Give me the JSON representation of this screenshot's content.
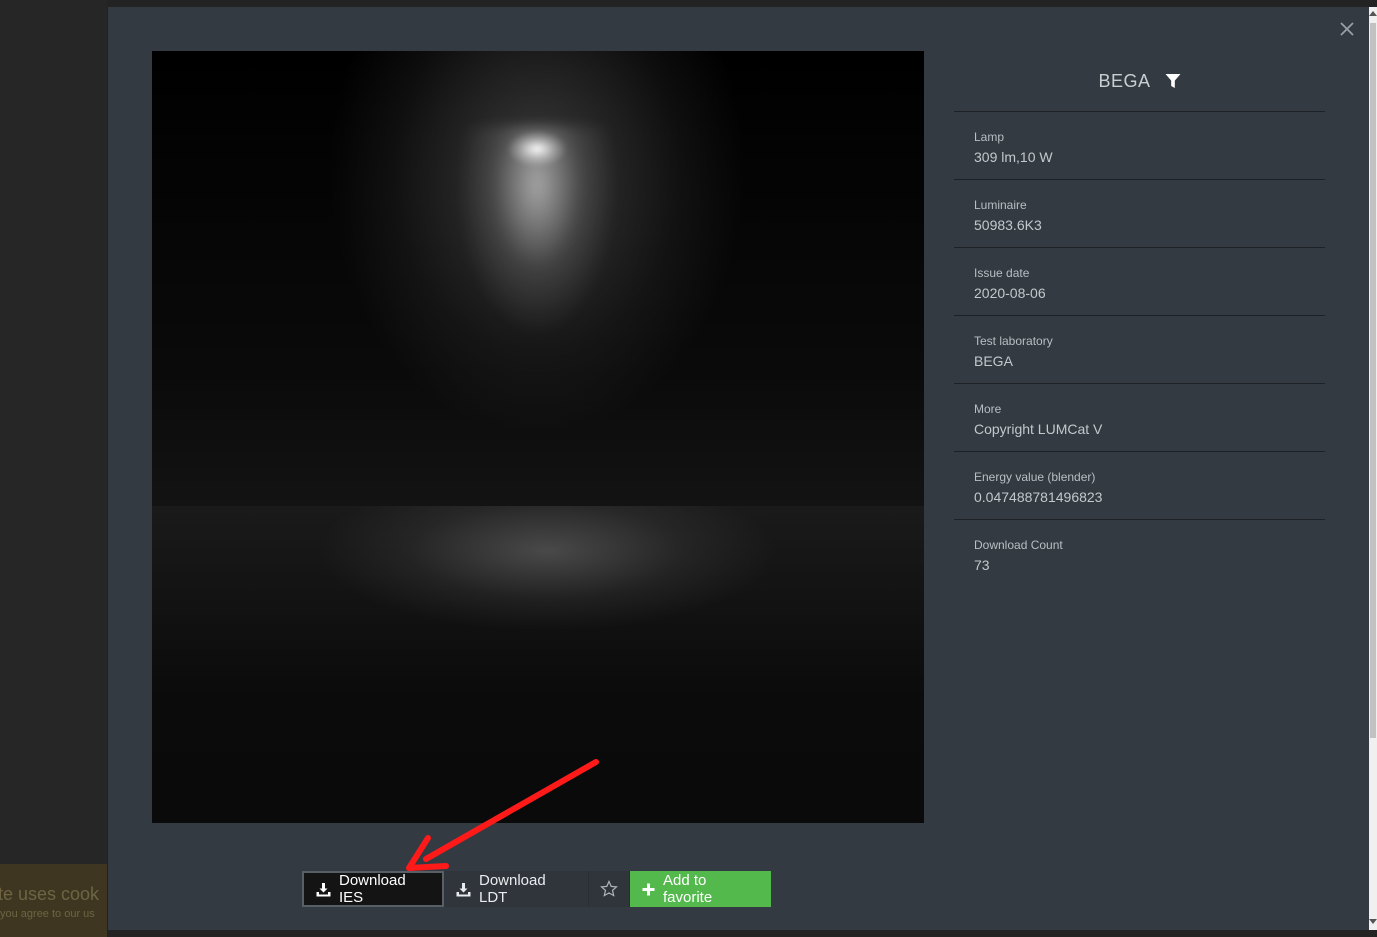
{
  "cookie": {
    "title": "te uses cook",
    "subtitle": "you agree to our us"
  },
  "modal": {
    "brand": "BEGA",
    "properties": [
      {
        "label": "Lamp",
        "value": "309 lm,10 W"
      },
      {
        "label": "Luminaire",
        "value": "50983.6K3"
      },
      {
        "label": "Issue date",
        "value": "2020-08-06"
      },
      {
        "label": "Test laboratory",
        "value": "BEGA"
      },
      {
        "label": "More",
        "value": "Copyright LUMCat V"
      },
      {
        "label": "Energy value (blender)",
        "value": "0.047488781496823"
      },
      {
        "label": "Download Count",
        "value": "73"
      }
    ],
    "buttons": {
      "download_ies": "Download IES",
      "download_ldt": "Download LDT",
      "add_favorite": "Add to favorite"
    }
  },
  "colors": {
    "modal_bg": "#343a41",
    "favorite_green": "#54b94d",
    "annotation_arrow": "#ff1a1a"
  },
  "icons": [
    "close-icon",
    "filter-icon",
    "download-icon",
    "star-icon",
    "plus-icon"
  ]
}
